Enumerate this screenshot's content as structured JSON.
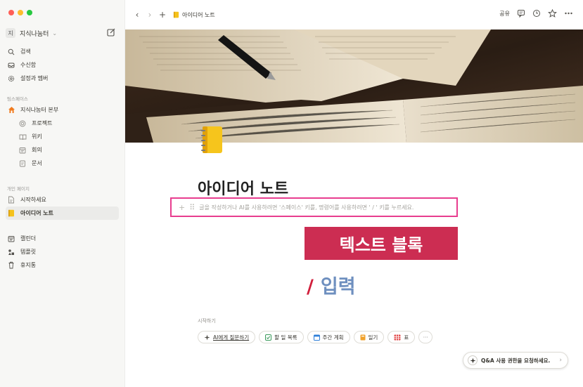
{
  "colors": {
    "accent_pink": "#e83d8f",
    "banner_red": "#cc2d52",
    "slash_red": "#d11f3c",
    "input_blue": "#6e8fbf",
    "sidebar_bg": "#f7f7f5"
  },
  "sidebar": {
    "workspace_avatar": "지",
    "workspace_name": "지식나눔터",
    "top_items": [
      {
        "label": "검색",
        "icon": "search-icon"
      },
      {
        "label": "수신함",
        "icon": "inbox-icon"
      },
      {
        "label": "설정과 멤버",
        "icon": "gear-icon"
      }
    ],
    "teamspace_label": "팀스페이스",
    "teamspace_root": {
      "label": "지식나눔터 본부",
      "icon": "home-icon"
    },
    "teamspace_items": [
      {
        "label": "프로젝트",
        "icon": "target-icon"
      },
      {
        "label": "위키",
        "icon": "book-icon"
      },
      {
        "label": "회의",
        "icon": "calendar-icon"
      },
      {
        "label": "문서",
        "icon": "document-icon"
      }
    ],
    "private_label": "개인 페이지",
    "private_items": [
      {
        "label": "시작하세요",
        "icon": "page-icon"
      },
      {
        "label": "아이디어 노트",
        "icon": "notebook-icon"
      }
    ],
    "bottom_items": [
      {
        "label": "캘린더",
        "icon": "calendar-icon"
      },
      {
        "label": "템플릿",
        "icon": "shapes-icon"
      },
      {
        "label": "휴지통",
        "icon": "trash-icon"
      }
    ]
  },
  "topbar": {
    "breadcrumb": "아이디어 노트",
    "share_label": "공유"
  },
  "page": {
    "title": "아이디어 노트",
    "placeholder": "글을 작성하거나 AI를 사용하려면 '스페이스' 키를, 명령어를 사용하려면 ' / ' 키를 누르세요.",
    "banner_text": "텍스트 블록",
    "slash_symbol": "/",
    "slash_word": "입력",
    "start_label": "시작하기",
    "chips": [
      {
        "label": "AI에게 질문하기",
        "icon": "ai-sparkle-icon"
      },
      {
        "label": "할 일 목록",
        "icon": "checkbox-icon"
      },
      {
        "label": "주간 계획",
        "icon": "calendar-icon"
      },
      {
        "label": "일기",
        "icon": "journal-icon"
      },
      {
        "label": "표",
        "icon": "table-icon"
      }
    ],
    "more_label": "···",
    "qa_button": "Q&A 사용 권한을 요청하세요."
  }
}
